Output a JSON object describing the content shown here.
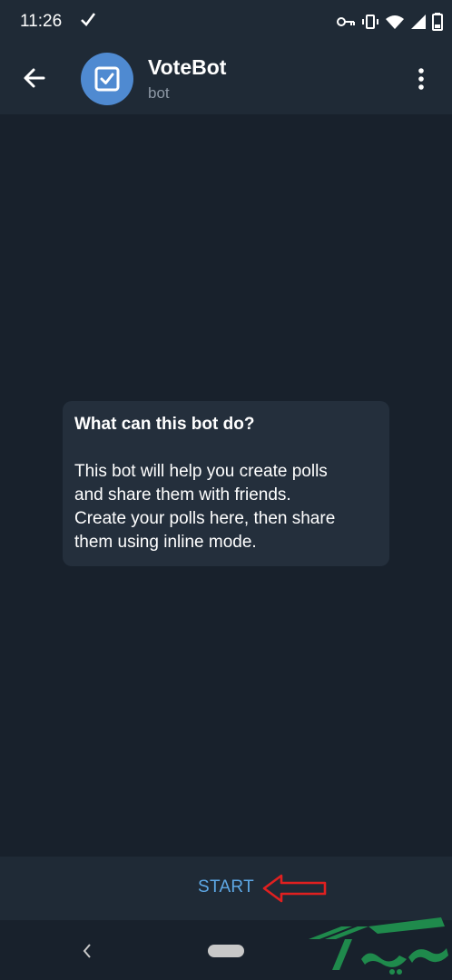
{
  "status_bar": {
    "time": "11:26",
    "icons": [
      "check-icon",
      "vpn-key-icon",
      "vibrate-icon",
      "wifi-icon",
      "signal-icon",
      "battery-icon"
    ]
  },
  "header": {
    "title": "VoteBot",
    "subtitle": "bot",
    "avatar_icon": "checkbox-icon"
  },
  "info_card": {
    "title": "What can this bot do?",
    "body_lines": [
      "This bot will help you create polls",
      "and share them with friends.",
      "Create your polls here, then share",
      "them using inline mode."
    ]
  },
  "bottom": {
    "start_label": "START"
  },
  "colors": {
    "background": "#18212c",
    "bar": "#1f2a36",
    "card": "#242f3c",
    "accent": "#5ea8e6",
    "avatar": "#4f8ad1",
    "annotation_arrow": "#e02020"
  }
}
